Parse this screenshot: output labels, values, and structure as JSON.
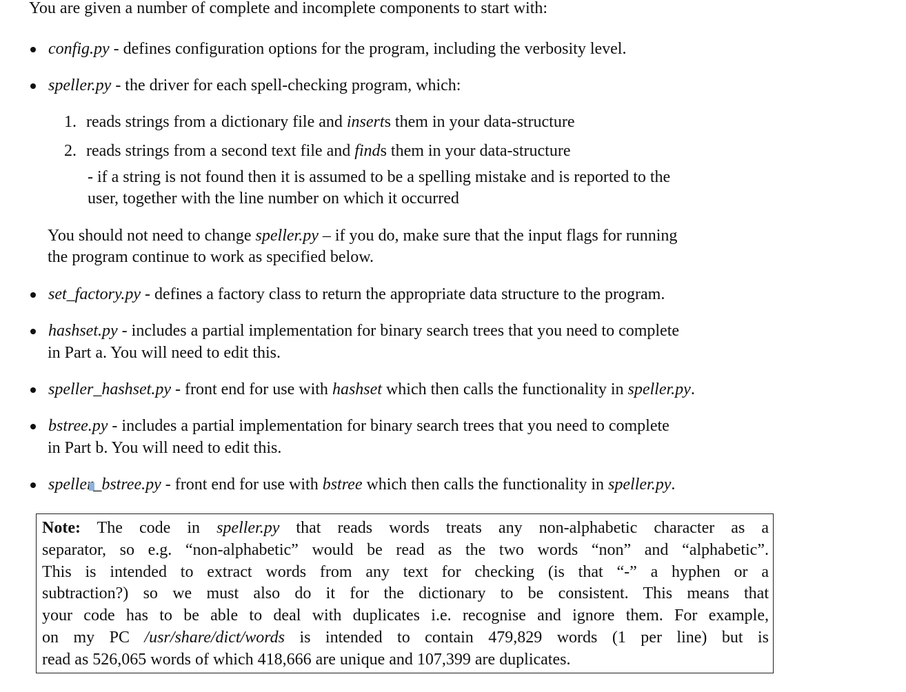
{
  "intro": "You are given a number of complete and incomplete components to start with:",
  "items": [
    {
      "file": "config.py",
      "desc": " - defines configuration options for the program, including the verbosity level."
    },
    {
      "file": "speller.py",
      "desc": " - the driver for each spell-checking program, which:"
    },
    {
      "file": "set_factory.py",
      "desc": " - defines a factory class to return the appropriate data structure to the program."
    },
    {
      "file": "hashset.py",
      "desc_line1": " - includes a partial implementation for binary search trees that you need to complete",
      "desc_line2": "in Part a. You will need to edit this."
    },
    {
      "file": "speller_hashset.py",
      "desc_a": " - front end for use with ",
      "mid": "hashset",
      "desc_b": " which then calls the functionality in ",
      "end": "speller.py",
      "desc_c": "."
    },
    {
      "file": "bstree.py",
      "desc_line1": " - includes a partial implementation for binary search trees that you need to complete",
      "desc_line2": "in Part b. You will need to edit this."
    },
    {
      "file_a": "speller",
      "file_b": "_bstree.py",
      "desc_a": " - front end for use with ",
      "mid": "bstree",
      "desc_b": " which then calls the functionality in ",
      "end": "speller.py",
      "desc_c": "."
    }
  ],
  "steps": [
    {
      "num": "1.",
      "a": "reads strings from a dictionary file and ",
      "em": "insert",
      "b": "s them in your data-structure"
    },
    {
      "num": "2.",
      "a": "reads strings from a second text file and ",
      "em": "find",
      "b": "s them in your data-structure"
    }
  ],
  "sub_note": {
    "line1": "- if a string is not found then it is assumed to be a spelling mistake and is reported to the",
    "line2": "user, together with the line number on which it occurred"
  },
  "speller_para": {
    "a": "You should not need to change ",
    "em": "speller.py",
    "b": " – if you do, make sure that the input flags for running",
    "line2": "the program continue to work as specified below."
  },
  "note": {
    "label": "Note:",
    "l1a": " The code in ",
    "l1em": "speller.py",
    "l1b": " that reads words treats any non-alphabetic character as a",
    "l2": "separator, so e.g. “non-alphabetic” would be read as the two words “non” and “alphabetic”.",
    "l3": "This is intended to extract words from any text for checking (is that “-” a hyphen or a",
    "l4": "subtraction?)  so we must also do it for the dictionary to be consistent.  This means that",
    "l5": "your code has to be able to deal with duplicates i.e. recognise and ignore them.  For example,",
    "l6a": "on my PC ",
    "l6em": "/usr/share/dict/words",
    "l6b": " is intended to contain 479,829 words (1 per line) but is",
    "l7": "read as 526,065 words of which 418,666 are unique and 107,399 are duplicates."
  }
}
